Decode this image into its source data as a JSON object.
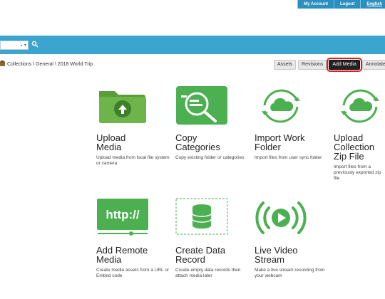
{
  "top_nav": {
    "my_account": "My Account",
    "logout": "Logout",
    "language": "English"
  },
  "search": {
    "value": ""
  },
  "breadcrumb": {
    "path": "Collections \\ General \\ 2018 World Trip"
  },
  "tabs": [
    {
      "label": "Assets"
    },
    {
      "label": "Revisions"
    },
    {
      "label": "Add Media",
      "active": true
    },
    {
      "label": "Annotate"
    }
  ],
  "tiles": [
    {
      "icon": "upload-folder-icon",
      "title_lines": [
        "Upload",
        "Media"
      ],
      "desc": "Upload media from local file system or camera"
    },
    {
      "icon": "copy-categories-icon",
      "title_lines": [
        "Copy",
        "Categories"
      ],
      "desc": "Copy existing folder or categories"
    },
    {
      "icon": "cloud-sync-icon",
      "title_lines": [
        "Import Work",
        "Folder"
      ],
      "desc": "Import files from user sync folder"
    },
    {
      "icon": "cloud-sync-icon",
      "title_lines": [
        "Upload",
        "Collection",
        "Zip File"
      ],
      "desc": "Import files from a previously exported zip file"
    },
    {
      "icon": "http-link-icon",
      "title_lines": [
        "Add Remote",
        "Media"
      ],
      "desc": "Create media assets from a URL or Embed code"
    },
    {
      "icon": "database-icon",
      "title_lines": [
        "Create Data",
        "Record"
      ],
      "desc": "Create empty data records then attach media later"
    },
    {
      "icon": "live-stream-icon",
      "title_lines": [
        "Live Video",
        "Stream"
      ],
      "desc": "Make a live stream recording from your webcam"
    }
  ],
  "colors": {
    "accent": "#3ba4cf",
    "icon_green": "#4caf50",
    "highlight_red": "#e01b22"
  }
}
